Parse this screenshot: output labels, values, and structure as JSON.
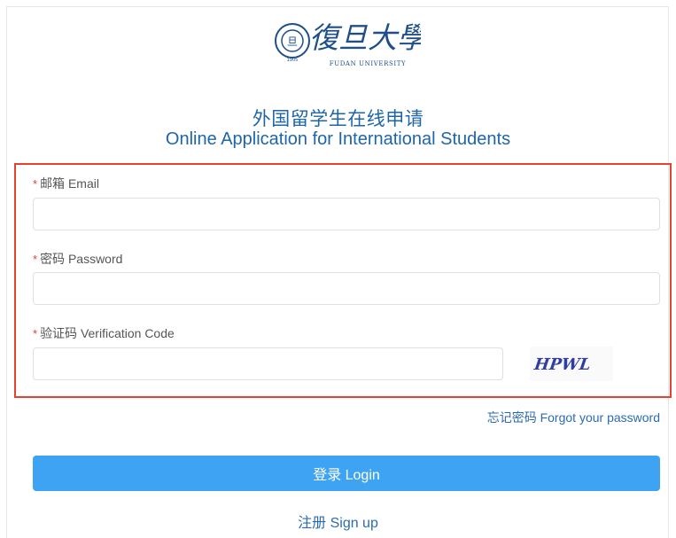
{
  "logo": {
    "seal_text": "FUDAN UNIVERSITY",
    "seal_year": "1905",
    "calligraphy": "復旦大學",
    "subtitle": "FUDAN UNIVERSITY"
  },
  "header": {
    "title_cn": "外国留学生在线申请",
    "title_en": "Online Application for International Students"
  },
  "form": {
    "required_mark": "*",
    "email_label": "邮箱 Email",
    "email_value": "",
    "password_label": "密码 Password",
    "password_value": "",
    "code_label": "验证码 Verification Code",
    "code_value": "",
    "captcha_text": "HPWL"
  },
  "links": {
    "forgot": "忘记密码 Forgot your password",
    "signup": "注册 Sign up"
  },
  "buttons": {
    "login": "登录 Login"
  },
  "colors": {
    "brand_blue": "#1e66a8",
    "button_blue": "#3ea3f2",
    "highlight_red": "#e5432e"
  }
}
